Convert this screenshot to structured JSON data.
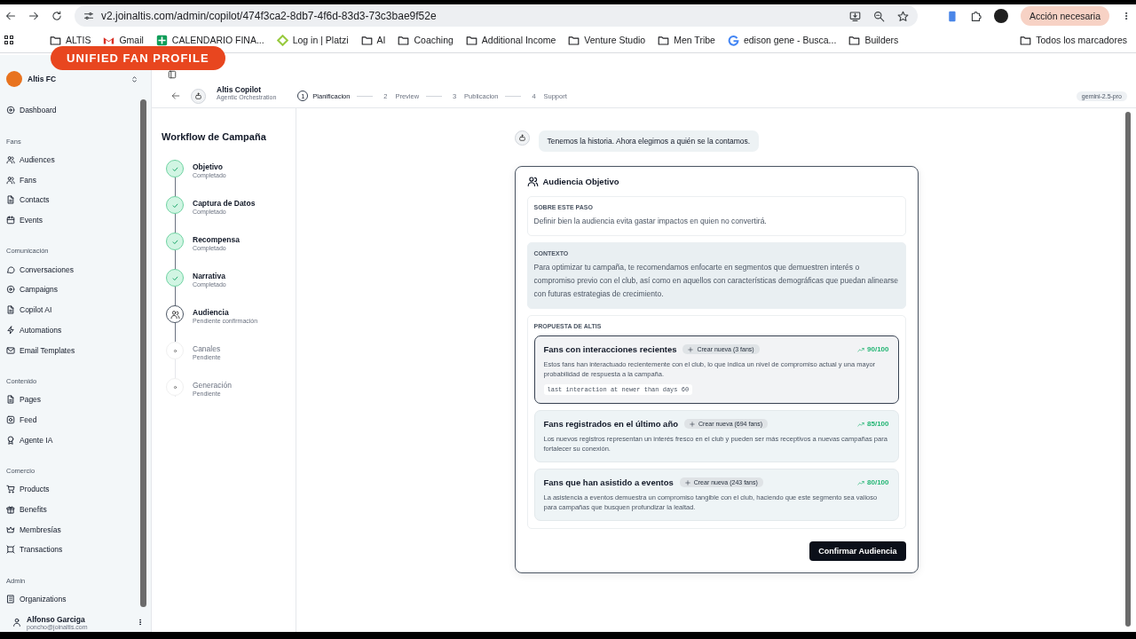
{
  "browser": {
    "url": "v2.joinaltis.com/admin/copilot/474f3ca2-8db7-4f6d-83d3-73c3bae9f52e",
    "action_button": "Acción necesaria"
  },
  "bookmarks": [
    {
      "label": "ALTIS",
      "kind": "folder"
    },
    {
      "label": "Gmail",
      "kind": "gmail"
    },
    {
      "label": "CALENDARIO FINA...",
      "kind": "sheet"
    },
    {
      "label": "Log in | Platzi",
      "kind": "platzi"
    },
    {
      "label": "AI",
      "kind": "folder"
    },
    {
      "label": "Coaching",
      "kind": "folder"
    },
    {
      "label": "Additional Income",
      "kind": "folder"
    },
    {
      "label": "Venture Studio",
      "kind": "folder"
    },
    {
      "label": "Men Tribe",
      "kind": "folder"
    },
    {
      "label": "edison gene - Busca...",
      "kind": "google"
    },
    {
      "label": "Builders",
      "kind": "folder"
    }
  ],
  "all_bookmarks": "Todos los marcadores",
  "overlay_badge": "UNIFIED FAN PROFILE",
  "org": {
    "name": "Altis FC"
  },
  "sidebar": {
    "sections": [
      {
        "items": [
          "Dashboard"
        ]
      },
      {
        "title": "Fans",
        "items": [
          "Audiences",
          "Fans",
          "Contacts",
          "Events"
        ]
      },
      {
        "title": "Comunicación",
        "items": [
          "Conversaciones",
          "Campaigns",
          "Copilot AI",
          "Automations",
          "Email Templates"
        ]
      },
      {
        "title": "Contenido",
        "items": [
          "Pages",
          "Feed",
          "Agente IA"
        ]
      },
      {
        "title": "Comercio",
        "items": [
          "Products",
          "Benefits",
          "Membresías",
          "Transactions"
        ]
      },
      {
        "title": "Admin",
        "items": [
          "Organizations"
        ]
      }
    ]
  },
  "user": {
    "name": "Alfonso Garciga",
    "email": "poncho@joinaltis.com"
  },
  "copilot": {
    "title": "Altis Copilot",
    "subtitle": "Agentic Orchestration",
    "model": "gemini-2.5-pro",
    "steps": [
      {
        "number": "1",
        "label": "Planificacion",
        "selected": true
      },
      {
        "number": "2",
        "label": "Preview",
        "selected": false
      },
      {
        "number": "3",
        "label": "Publicacion",
        "selected": false
      },
      {
        "number": "4",
        "label": "Support",
        "selected": false
      }
    ]
  },
  "workflow": {
    "title": "Workflow de Campaña",
    "steps": [
      {
        "label": "Objetivo",
        "status": "Completado",
        "kind": "done"
      },
      {
        "label": "Captura de Datos",
        "status": "Completado",
        "kind": "done"
      },
      {
        "label": "Recompensa",
        "status": "Completado",
        "kind": "done"
      },
      {
        "label": "Narrativa",
        "status": "Completado",
        "kind": "done"
      },
      {
        "label": "Audiencia",
        "status": "Pendiente confirmación",
        "kind": "current"
      },
      {
        "label": "Canales",
        "status": "Pendiente",
        "kind": "pending"
      },
      {
        "label": "Generación",
        "status": "Pendiente",
        "kind": "pending"
      }
    ]
  },
  "message": "Tenemos la historia. Ahora elegimos a quién se la contamos.",
  "card": {
    "title": "Audiencia Objetivo",
    "about": {
      "label": "SOBRE ESTE PASO",
      "text": "Definir bien la audiencia evita gastar impactos en quien no convertirá."
    },
    "context": {
      "label": "CONTEXTO",
      "text": "Para optimizar tu campaña, te recomendamos enfocarte en segmentos que demuestren interés o compromiso previo con el club, así como en aquellos con características demográficas que puedan alinearse con futuras estrategias de crecimiento."
    },
    "proposal": {
      "label": "PROPUESTA DE ALTIS",
      "segments": [
        {
          "title": "Fans con interacciones recientes",
          "create": "Crear nueva (3 fans)",
          "score": "90/100",
          "description": "Estos fans han interactuado recientemente con el club, lo que indica un nivel de compromiso actual y una mayor probabilidad de respuesta a la campaña.",
          "filter": "last interaction at newer than days 60",
          "selected": true
        },
        {
          "title": "Fans registrados en el último año",
          "create": "Crear nueva (694 fans)",
          "score": "85/100",
          "description": "Los nuevos registros representan un interés fresco en el club y pueden ser más receptivos a nuevas campañas para fortalecer su conexión.",
          "selected": false
        },
        {
          "title": "Fans que han asistido a eventos",
          "create": "Crear nueva (243 fans)",
          "score": "80/100",
          "description": "La asistencia a eventos demuestra un compromiso tangible con el club, haciendo que este segmento sea valioso para campañas que busquen profundizar la lealtad.",
          "selected": false
        }
      ]
    },
    "confirm": "Confirmar Audiencia"
  }
}
